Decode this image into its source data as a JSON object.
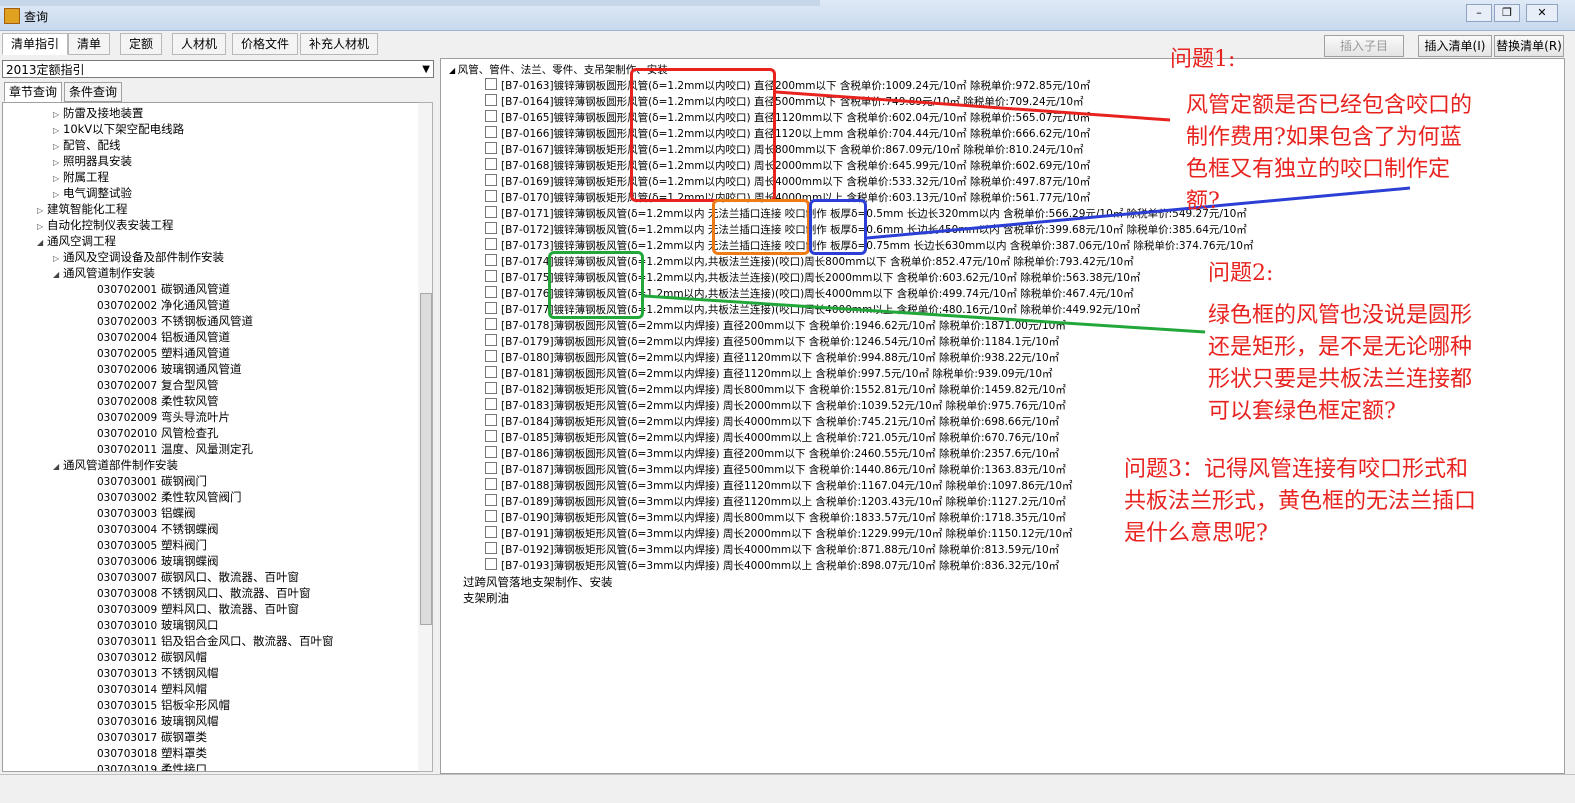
{
  "window": {
    "title": "查询"
  },
  "toolbar": {
    "tabs": [
      "清单指引",
      "清单",
      "定额",
      "人材机",
      "价格文件",
      "补充人材机"
    ],
    "insert_child": "插入子目",
    "insert_list": "插入清单(I)",
    "replace_list": "替换清单(R)"
  },
  "left": {
    "combo_value": "2013定额指引",
    "subtabs": [
      "章节查询",
      "条件查询"
    ],
    "tree": [
      {
        "level": 3,
        "toggle": "▷",
        "code": "",
        "label": "防雷及接地装置"
      },
      {
        "level": 3,
        "toggle": "▷",
        "code": "",
        "label": "10kV以下架空配电线路"
      },
      {
        "level": 3,
        "toggle": "▷",
        "code": "",
        "label": "配管、配线"
      },
      {
        "level": 3,
        "toggle": "▷",
        "code": "",
        "label": "照明器具安装"
      },
      {
        "level": 3,
        "toggle": "▷",
        "code": "",
        "label": "附属工程"
      },
      {
        "level": 3,
        "toggle": "▷",
        "code": "",
        "label": "电气调整试验"
      },
      {
        "level": 2,
        "toggle": "▷",
        "code": "",
        "label": "建筑智能化工程"
      },
      {
        "level": 2,
        "toggle": "▷",
        "code": "",
        "label": "自动化控制仪表安装工程"
      },
      {
        "level": 2,
        "toggle": "◢",
        "code": "",
        "label": "通风空调工程"
      },
      {
        "level": 3,
        "toggle": "▷",
        "code": "",
        "label": "通风及空调设备及部件制作安装"
      },
      {
        "level": 3,
        "toggle": "◢",
        "code": "",
        "label": "通风管道制作安装"
      },
      {
        "level": 4,
        "toggle": "",
        "code": "030702001",
        "label": "碳钢通风管道"
      },
      {
        "level": 4,
        "toggle": "",
        "code": "030702002",
        "label": "净化通风管道"
      },
      {
        "level": 4,
        "toggle": "",
        "code": "030702003",
        "label": "不锈钢板通风管道"
      },
      {
        "level": 4,
        "toggle": "",
        "code": "030702004",
        "label": "铝板通风管道"
      },
      {
        "level": 4,
        "toggle": "",
        "code": "030702005",
        "label": "塑料通风管道"
      },
      {
        "level": 4,
        "toggle": "",
        "code": "030702006",
        "label": "玻璃钢通风管道"
      },
      {
        "level": 4,
        "toggle": "",
        "code": "030702007",
        "label": "复合型风管"
      },
      {
        "level": 4,
        "toggle": "",
        "code": "030702008",
        "label": "柔性软风管"
      },
      {
        "level": 4,
        "toggle": "",
        "code": "030702009",
        "label": "弯头导流叶片"
      },
      {
        "level": 4,
        "toggle": "",
        "code": "030702010",
        "label": "风管检查孔"
      },
      {
        "level": 4,
        "toggle": "",
        "code": "030702011",
        "label": "温度、风量测定孔"
      },
      {
        "level": 3,
        "toggle": "◢",
        "code": "",
        "label": "通风管道部件制作安装"
      },
      {
        "level": 4,
        "toggle": "",
        "code": "030703001",
        "label": "碳钢阀门"
      },
      {
        "level": 4,
        "toggle": "",
        "code": "030703002",
        "label": "柔性软风管阀门"
      },
      {
        "level": 4,
        "toggle": "",
        "code": "030703003",
        "label": "铝蝶阀"
      },
      {
        "level": 4,
        "toggle": "",
        "code": "030703004",
        "label": "不锈钢蝶阀"
      },
      {
        "level": 4,
        "toggle": "",
        "code": "030703005",
        "label": "塑料阀门"
      },
      {
        "level": 4,
        "toggle": "",
        "code": "030703006",
        "label": "玻璃钢蝶阀"
      },
      {
        "level": 4,
        "toggle": "",
        "code": "030703007",
        "label": "碳钢风口、散流器、百叶窗"
      },
      {
        "level": 4,
        "toggle": "",
        "code": "030703008",
        "label": "不锈钢风口、散流器、百叶窗"
      },
      {
        "level": 4,
        "toggle": "",
        "code": "030703009",
        "label": "塑料风口、散流器、百叶窗"
      },
      {
        "level": 4,
        "toggle": "",
        "code": "030703010",
        "label": "玻璃钢风口"
      },
      {
        "level": 4,
        "toggle": "",
        "code": "030703011",
        "label": "铝及铝合金风口、散流器、百叶窗"
      },
      {
        "level": 4,
        "toggle": "",
        "code": "030703012",
        "label": "碳钢风帽"
      },
      {
        "level": 4,
        "toggle": "",
        "code": "030703013",
        "label": "不锈钢风帽"
      },
      {
        "level": 4,
        "toggle": "",
        "code": "030703014",
        "label": "塑料风帽"
      },
      {
        "level": 4,
        "toggle": "",
        "code": "030703015",
        "label": "铝板伞形风帽"
      },
      {
        "level": 4,
        "toggle": "",
        "code": "030703016",
        "label": "玻璃钢风帽"
      },
      {
        "level": 4,
        "toggle": "",
        "code": "030703017",
        "label": "碳钢罩类"
      },
      {
        "level": 4,
        "toggle": "",
        "code": "030703018",
        "label": "塑料罩类"
      },
      {
        "level": 4,
        "toggle": "",
        "code": "030703019",
        "label": "柔性接口"
      }
    ]
  },
  "main": {
    "root": "风管、管件、法兰、零件、支吊架制作、安装",
    "rows": [
      "[B7-0163]镀锌薄钢板圆形风管(δ=1.2mm以内咬口) 直径200mm以下 含税单价:1009.24元/10㎡ 除税单价:972.85元/10㎡",
      "[B7-0164]镀锌薄钢板圆形风管(δ=1.2mm以内咬口) 直径500mm以下 含税单价:749.89元/10㎡ 除税单价:709.24元/10㎡",
      "[B7-0165]镀锌薄钢板圆形风管(δ=1.2mm以内咬口) 直径1120mm以下 含税单价:602.04元/10㎡ 除税单价:565.07元/10㎡",
      "[B7-0166]镀锌薄钢板圆形风管(δ=1.2mm以内咬口) 直径1120以上mm 含税单价:704.44元/10㎡ 除税单价:666.62元/10㎡",
      "[B7-0167]镀锌薄钢板矩形风管(δ=1.2mm以内咬口) 周长800mm以下 含税单价:867.09元/10㎡ 除税单价:810.24元/10㎡",
      "[B7-0168]镀锌薄钢板矩形风管(δ=1.2mm以内咬口) 周长2000mm以下 含税单价:645.99元/10㎡ 除税单价:602.69元/10㎡",
      "[B7-0169]镀锌薄钢板矩形风管(δ=1.2mm以内咬口) 周长4000mm以下 含税单价:533.32元/10㎡ 除税单价:497.87元/10㎡",
      "[B7-0170]镀锌薄钢板矩形风管(δ=1.2mm以内咬口) 周长4000mm以上 含税单价:603.13元/10㎡ 除税单价:561.77元/10㎡",
      "[B7-0171]镀锌薄钢板风管(δ=1.2mm以内 无法兰插口连接 咬口制作 板厚δ=0.5mm 长边长320mm以内 含税单价:566.29元/10㎡ 除税单价:549.27元/10㎡",
      "[B7-0172]镀锌薄钢板风管(δ=1.2mm以内 无法兰插口连接 咬口制作 板厚δ=0.6mm 长边长450mm以内 含税单价:399.68元/10㎡ 除税单价:385.64元/10㎡",
      "[B7-0173]镀锌薄钢板风管(δ=1.2mm以内 无法兰插口连接 咬口制作 板厚δ=0.75mm 长边长630mm以内 含税单价:387.06元/10㎡ 除税单价:374.76元/10㎡",
      "[B7-0174]镀锌薄钢板风管(δ=1.2mm以内,共板法兰连接)(咬口)周长800mm以下 含税单价:852.47元/10㎡ 除税单价:793.42元/10㎡",
      "[B7-0175]镀锌薄钢板风管(δ=1.2mm以内,共板法兰连接)(咬口)周长2000mm以下 含税单价:603.62元/10㎡ 除税单价:563.38元/10㎡",
      "[B7-0176]镀锌薄钢板风管(δ=1.2mm以内,共板法兰连接)(咬口)周长4000mm以下 含税单价:499.74元/10㎡ 除税单价:467.4元/10㎡",
      "[B7-0177]镀锌薄钢板风管(δ=1.2mm以内,共板法兰连接)(咬口)周长4000mm以上 含税单价:480.16元/10㎡ 除税单价:449.92元/10㎡",
      "[B7-0178]薄钢板圆形风管(δ=2mm以内焊接) 直径200mm以下 含税单价:1946.62元/10㎡ 除税单价:1871.00元/10㎡",
      "[B7-0179]薄钢板圆形风管(δ=2mm以内焊接) 直径500mm以下 含税单价:1246.54元/10㎡ 除税单价:1184.1元/10㎡",
      "[B7-0180]薄钢板圆形风管(δ=2mm以内焊接) 直径1120mm以下 含税单价:994.88元/10㎡ 除税单价:938.22元/10㎡",
      "[B7-0181]薄钢板圆形风管(δ=2mm以内焊接) 直径1120mm以上 含税单价:997.5元/10㎡ 除税单价:939.09元/10㎡",
      "[B7-0182]薄钢板矩形风管(δ=2mm以内焊接) 周长800mm以下 含税单价:1552.81元/10㎡ 除税单价:1459.82元/10㎡",
      "[B7-0183]薄钢板矩形风管(δ=2mm以内焊接) 周长2000mm以下 含税单价:1039.52元/10㎡ 除税单价:975.76元/10㎡",
      "[B7-0184]薄钢板矩形风管(δ=2mm以内焊接) 周长4000mm以下 含税单价:745.21元/10㎡ 除税单价:698.66元/10㎡",
      "[B7-0185]薄钢板矩形风管(δ=2mm以内焊接) 周长4000mm以上 含税单价:721.05元/10㎡ 除税单价:670.76元/10㎡",
      "[B7-0186]薄钢板圆形风管(δ=3mm以内焊接) 直径200mm以下 含税单价:2460.55元/10㎡ 除税单价:2357.6元/10㎡",
      "[B7-0187]薄钢板圆形风管(δ=3mm以内焊接) 直径500mm以下 含税单价:1440.86元/10㎡ 除税单价:1363.83元/10㎡",
      "[B7-0188]薄钢板圆形风管(δ=3mm以内焊接) 直径1120mm以下 含税单价:1167.04元/10㎡ 除税单价:1097.86元/10㎡",
      "[B7-0189]薄钢板圆形风管(δ=3mm以内焊接) 直径1120mm以上 含税单价:1203.43元/10㎡ 除税单价:1127.2元/10㎡",
      "[B7-0190]薄钢板矩形风管(δ=3mm以内焊接) 周长800mm以下 含税单价:1833.57元/10㎡ 除税单价:1718.35元/10㎡",
      "[B7-0191]薄钢板矩形风管(δ=3mm以内焊接) 周长2000mm以下 含税单价:1229.99元/10㎡ 除税单价:1150.12元/10㎡",
      "[B7-0192]薄钢板矩形风管(δ=3mm以内焊接) 周长4000mm以下 含税单价:871.88元/10㎡ 除税单价:813.59元/10㎡",
      "[B7-0193]薄钢板矩形风管(δ=3mm以内焊接) 周长4000mm以上 含税单价:898.07元/10㎡ 除税单价:836.32元/10㎡"
    ],
    "tail_rows": [
      "过跨风管落地支架制作、安装",
      "支架刷油"
    ]
  },
  "annotations": {
    "q1_title": "问题1:",
    "q1_lines": [
      "风管定额是否已经包含咬口的",
      "制作费用?如果包含了为何蓝",
      "色框又有独立的咬口制作定",
      "额?"
    ],
    "q2_title": "问题2:",
    "q2_lines": [
      "绿色框的风管也没说是圆形",
      "还是矩形，是不是无论哪种",
      "形状只要是共板法兰连接都",
      "可以套绿色框定额?"
    ],
    "q3_lines": [
      "问题3：记得风管连接有咬口形式和",
      "共板法兰形式，黄色框的无法兰插口",
      "是什么意思呢?"
    ],
    "colors": {
      "red": "#e8231f",
      "orange": "#f07a14",
      "blue": "#2b3fd6",
      "green": "#22a83a"
    }
  }
}
